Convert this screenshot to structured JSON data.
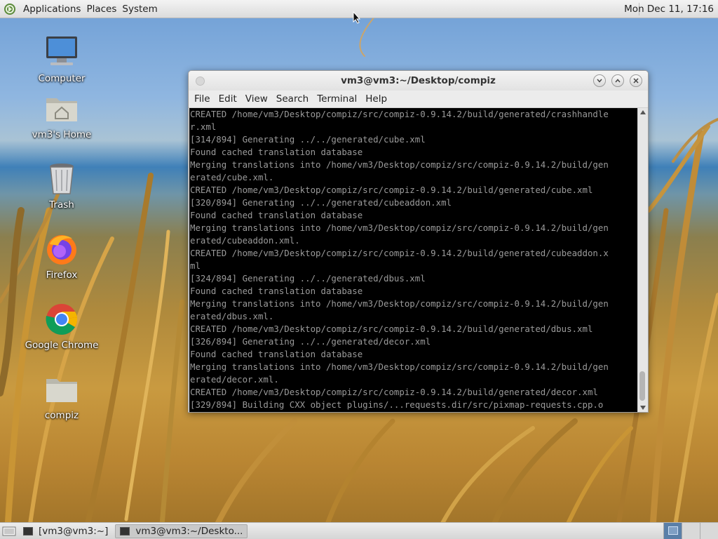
{
  "top_panel": {
    "menus": [
      "Applications",
      "Places",
      "System"
    ],
    "clock": "Mon Dec 11, 17:16"
  },
  "desktop": {
    "icons": [
      {
        "label": "Computer",
        "icon": "computer-icon"
      },
      {
        "label": "vm3's Home",
        "icon": "home-folder-icon"
      },
      {
        "label": "Trash",
        "icon": "trash-icon"
      },
      {
        "label": "Firefox",
        "icon": "firefox-icon"
      },
      {
        "label": "Google Chrome",
        "icon": "chrome-icon"
      },
      {
        "label": "compiz",
        "icon": "folder-icon"
      }
    ]
  },
  "window": {
    "title": "vm3@vm3:~/Desktop/compiz",
    "menu": [
      "File",
      "Edit",
      "View",
      "Search",
      "Terminal",
      "Help"
    ],
    "terminal_lines": [
      "CREATED /home/vm3/Desktop/compiz/src/compiz-0.9.14.2/build/generated/crashhandle",
      "r.xml",
      "[314/894] Generating ../../generated/cube.xml",
      "Found cached translation database",
      "Merging translations into /home/vm3/Desktop/compiz/src/compiz-0.9.14.2/build/gen",
      "erated/cube.xml.",
      "CREATED /home/vm3/Desktop/compiz/src/compiz-0.9.14.2/build/generated/cube.xml",
      "[320/894] Generating ../../generated/cubeaddon.xml",
      "Found cached translation database",
      "Merging translations into /home/vm3/Desktop/compiz/src/compiz-0.9.14.2/build/gen",
      "erated/cubeaddon.xml.",
      "CREATED /home/vm3/Desktop/compiz/src/compiz-0.9.14.2/build/generated/cubeaddon.x",
      "ml",
      "[324/894] Generating ../../generated/dbus.xml",
      "Found cached translation database",
      "Merging translations into /home/vm3/Desktop/compiz/src/compiz-0.9.14.2/build/gen",
      "erated/dbus.xml.",
      "CREATED /home/vm3/Desktop/compiz/src/compiz-0.9.14.2/build/generated/dbus.xml",
      "[326/894] Generating ../../generated/decor.xml",
      "Found cached translation database",
      "Merging translations into /home/vm3/Desktop/compiz/src/compiz-0.9.14.2/build/gen",
      "erated/decor.xml.",
      "CREATED /home/vm3/Desktop/compiz/src/compiz-0.9.14.2/build/generated/decor.xml",
      "[329/894] Building CXX object plugins/...requests.dir/src/pixmap-requests.cpp.o"
    ]
  },
  "bottom_panel": {
    "tasks": [
      "[vm3@vm3:~]",
      "vm3@vm3:~/Deskto..."
    ]
  },
  "colors": {
    "terminal_bg": "#000000",
    "terminal_fg": "#9a9a9a",
    "panel_bg": "#e6e6e6"
  }
}
